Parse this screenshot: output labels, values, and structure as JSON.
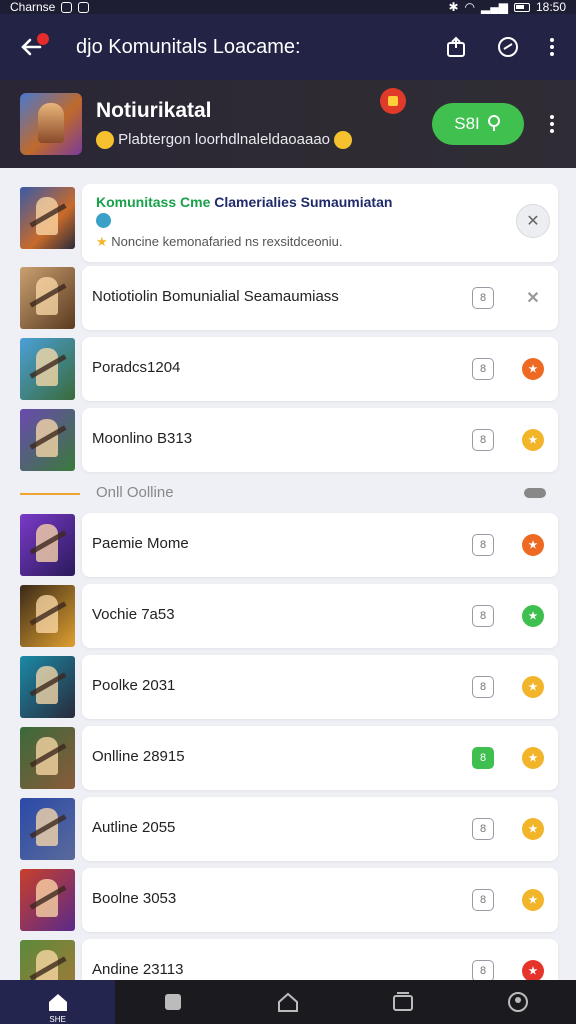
{
  "status_bar": {
    "carrier": "Charnse",
    "time": "18:50"
  },
  "app_bar": {
    "title": "djo Komunitals Loacame:"
  },
  "profile": {
    "name": "Notiurikatal",
    "subtitle": "Plabtergon loorhdlnaleldaoaaao",
    "button_label": "S8I"
  },
  "featured": {
    "title_accent": "Komunitass Cme",
    "title_rest": " Clamerialies Sumaumiatan",
    "subtitle": "Noncine kemonafaried ns rexsitdceoniu."
  },
  "divider": {
    "label": "Onll Oolline"
  },
  "rows_top": [
    {
      "title": "Notiotiolin Bomunialial Seamaumiass",
      "right_icon": "close",
      "thumb": [
        "#c9a070",
        "#5a3a20"
      ]
    },
    {
      "title": "Poradcs1204",
      "right_icon": "orange",
      "thumb": [
        "#4aa0d8",
        "#3a6a3a"
      ]
    },
    {
      "title": "Moonlino B313",
      "right_icon": "yellow",
      "thumb": [
        "#6a4ab0",
        "#3a7a3a"
      ]
    }
  ],
  "rows_bottom": [
    {
      "title": "Paemie Mome",
      "box": "plain",
      "right_icon": "orange",
      "thumb": [
        "#7a3ac8",
        "#2a1a5a"
      ]
    },
    {
      "title": "Vochie 7a53",
      "box": "plain",
      "right_icon": "green",
      "thumb": [
        "#3a2a18",
        "#e0a030"
      ]
    },
    {
      "title": "Poolke 2031",
      "box": "plain",
      "right_icon": "yellow",
      "thumb": [
        "#1a8aa8",
        "#2a2a3a"
      ]
    },
    {
      "title": "Onlline 28915",
      "box": "green",
      "right_icon": "yellow",
      "thumb": [
        "#3a6a3a",
        "#8a5a3a"
      ]
    },
    {
      "title": "Autline 2055",
      "box": "plain",
      "right_icon": "yellow",
      "thumb": [
        "#2a4aa8",
        "#5a6a9a"
      ]
    },
    {
      "title": "Boolne 3053",
      "box": "plain",
      "right_icon": "yellow",
      "thumb": [
        "#c8402a",
        "#5a2a8a"
      ]
    },
    {
      "title": "Andine 23113",
      "box": "plain",
      "right_icon": "red",
      "thumb": [
        "#5a8a3a",
        "#a8783a"
      ]
    }
  ],
  "colors": {
    "orange": "#ee6a22",
    "yellow": "#f2b52a",
    "green": "#3fbf4f",
    "red": "#e5342a",
    "accent_green": "#3fc04f"
  },
  "bottom_nav": {
    "active_label": "SHE"
  }
}
